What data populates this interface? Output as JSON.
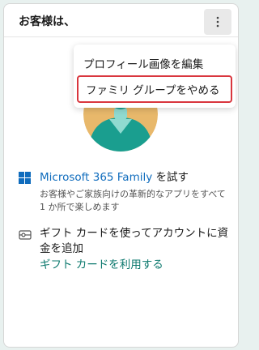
{
  "header": {
    "greeting": "お客様は、"
  },
  "menu": {
    "edit_profile_picture": "プロフィール画像を編集",
    "leave_family_group": "ファミリ グループをやめる"
  },
  "offer": {
    "title_link": "Microsoft 365 Family",
    "title_suffix": " を試す",
    "description": "お客様やご家族向けの革新的なアプリをすべて 1 か所で楽しめます"
  },
  "gift": {
    "text": "ギフト カードを使ってアカウントに資金を追加",
    "link": "ギフト カードを利用する"
  },
  "colors": {
    "highlight_border": "#d9363e",
    "link_blue": "#0f6cbd",
    "link_teal": "#0e7a6f",
    "avatar_bg": "#e8b86b",
    "avatar_body": "#1a9e8f"
  },
  "icons": {
    "more": "more-vertical-icon",
    "windows": "windows-logo-icon",
    "gift_card": "gift-card-icon",
    "avatar": "avatar-placeholder"
  }
}
